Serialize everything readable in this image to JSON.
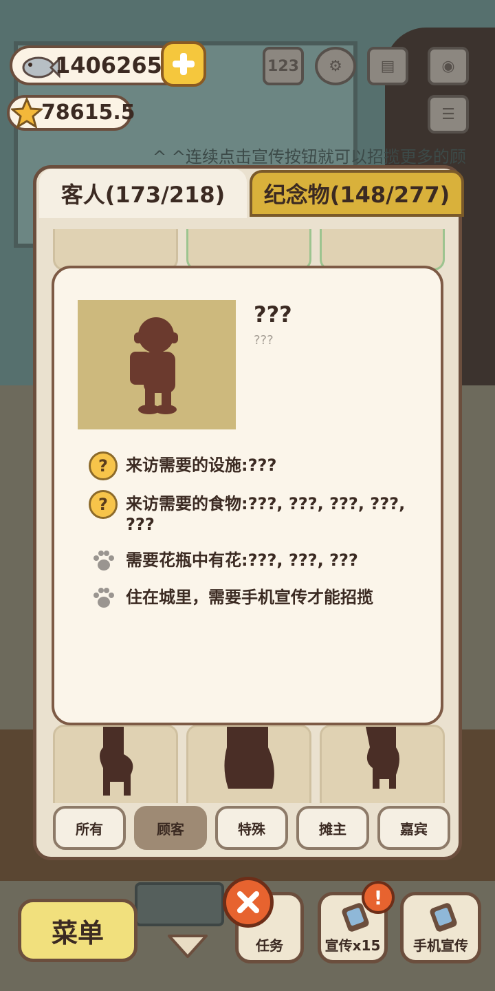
{
  "ticker": "^ ^连续点击宣传按钮就可以招揽更多的顾",
  "hud": {
    "fish_count": "14062654",
    "star_count": "78615.5"
  },
  "tabs": {
    "customers": "客人(173/218)",
    "souvenirs": "纪念物(148/277)"
  },
  "popup": {
    "name": "???",
    "subtitle": "???",
    "requirements": [
      {
        "icon": "question-icon",
        "text": "来访需要的设施:???"
      },
      {
        "icon": "question-icon",
        "text": "来访需要的食物:???, ???, ???, ???, ???"
      },
      {
        "icon": "paw-icon",
        "text": "需要花瓶中有花:???, ???, ???"
      },
      {
        "icon": "paw-icon",
        "text": "住在城里，需要手机宣传才能招揽"
      }
    ]
  },
  "filters": [
    "所有",
    "顾客",
    "特殊",
    "摊主",
    "嘉宾"
  ],
  "active_filter": "顾客",
  "bottom": {
    "menu": "菜单",
    "tasks": "任务",
    "promote": "宣传x15",
    "phone_promote": "手机宣传"
  },
  "colors": {
    "panel_border": "#6b4e3d",
    "accent_gold": "#d9b13b",
    "portrait_bg": "#cdb97d",
    "silhouette": "#6b3a2e"
  }
}
